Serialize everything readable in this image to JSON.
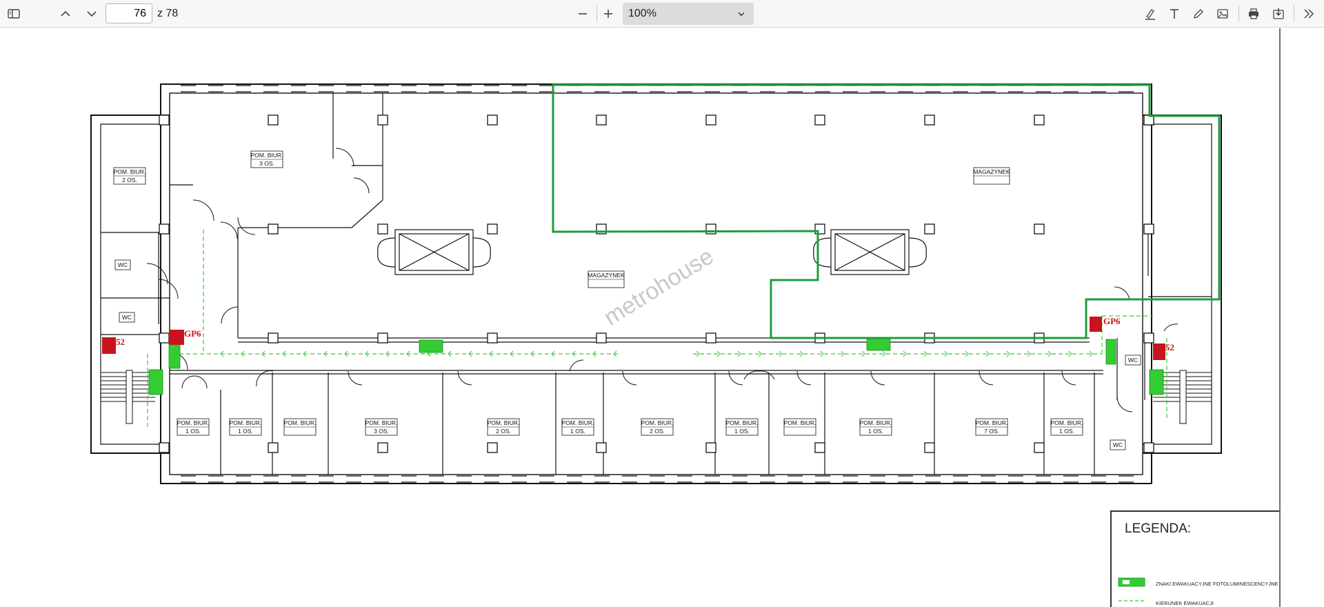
{
  "toolbar": {
    "page_current": "76",
    "page_total": "z 78",
    "zoom_value": "100%"
  },
  "plan": {
    "watermark": "metrohouse",
    "rooms": {
      "r_2os_left": {
        "name": "POM. BIUR.",
        "cap": "2 OS."
      },
      "r_3os_top": {
        "name": "POM. BIUR.",
        "cap": "3 OS."
      },
      "wc1": "WC",
      "wc2": "WC",
      "wc3": "WC",
      "wc4": "WC",
      "magazynek_center": "MAGAZYNEK",
      "magazynek_right": "MAGAZYNEK",
      "b1": {
        "name": "POM. BIUR.",
        "cap": "1 OS."
      },
      "b2": {
        "name": "POM. BIUR.",
        "cap": "1 OS."
      },
      "b3": {
        "name": "POM. BIUR.",
        "cap": ""
      },
      "b4": {
        "name": "POM. BIUR.",
        "cap": "3 OS."
      },
      "b5": {
        "name": "POM. BIUR.",
        "cap": "2 OS."
      },
      "b6": {
        "name": "POM. BIUR.",
        "cap": "1 OS."
      },
      "b7": {
        "name": "POM. BIUR.",
        "cap": "2 OS."
      },
      "b8": {
        "name": "POM. BIUR.",
        "cap": "1 OS."
      },
      "b9": {
        "name": "POM. BIUR.",
        "cap": ""
      },
      "b10": {
        "name": "POM. BIUR.",
        "cap": "1 OS."
      },
      "b11": {
        "name": "POM. BIUR.",
        "cap": "7 OS."
      },
      "b12": {
        "name": "POM. BIUR.",
        "cap": "1 OS."
      }
    },
    "gp_left": "GP6",
    "gp_right": "GP6",
    "hydrant_left": "52",
    "hydrant_right": "52"
  },
  "legend": {
    "title": "LEGENDA:",
    "item1": "ZNAKI EWAKUACYJNE FOTOLUMINESCENCYJNE",
    "item2": "KIERUNEK EWAKUACJI"
  },
  "colors": {
    "highlight_green": "#1e9c3c",
    "evac_green": "#33cc33",
    "fire_red": "#c8141e"
  }
}
